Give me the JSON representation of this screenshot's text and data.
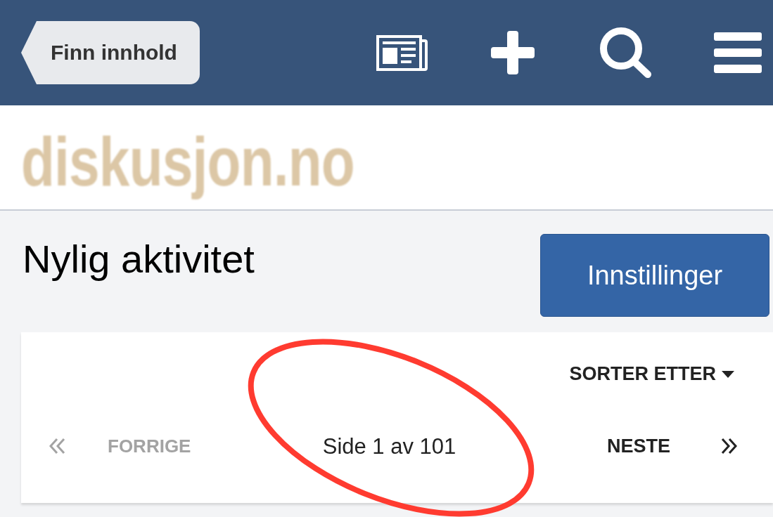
{
  "header": {
    "back_button": {
      "label": "Finn innhold"
    }
  },
  "logo": {
    "text": "diskusjon.no"
  },
  "page": {
    "title": "Nylig aktivitet",
    "settings_button": {
      "label": "Innstillinger"
    }
  },
  "pager": {
    "sort": {
      "label": "SORTER ETTER"
    },
    "first": {
      "disabled": true
    },
    "previous": {
      "label": "FORRIGE",
      "disabled": true
    },
    "status": "Side 1 av 101",
    "next": {
      "label": "NESTE",
      "disabled": false
    },
    "last": {
      "disabled": false
    }
  },
  "annotation": {
    "kind": "ellipse"
  }
}
